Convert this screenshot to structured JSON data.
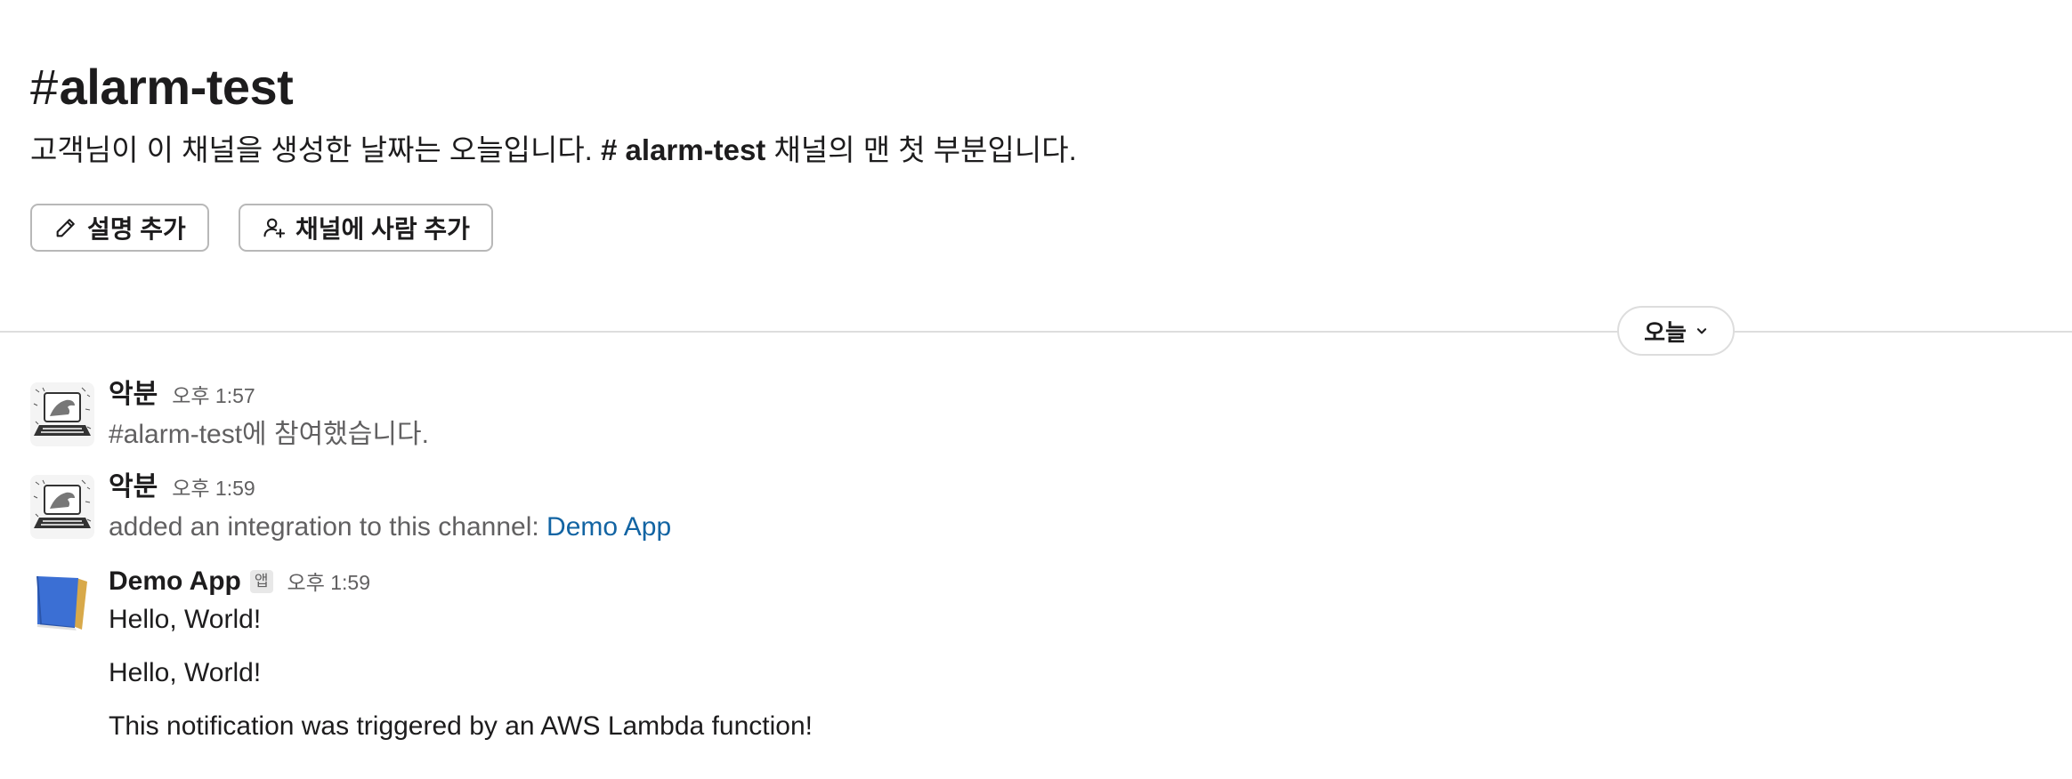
{
  "channel": {
    "hash": "#",
    "name": "alarm-test"
  },
  "intro": {
    "before": "고객님이 이 채널을 생성한 날짜는 오늘입니다.",
    "channel_ref": "# alarm-test",
    "after": "채널의 맨 첫 부분입니다."
  },
  "buttons": {
    "add_description": "설명 추가",
    "add_people": "채널에 사람 추가"
  },
  "date_divider": {
    "label": "오늘"
  },
  "messages": [
    {
      "author": "악분",
      "time": "오후 1:57",
      "text": "#alarm-test에 참여했습니다."
    },
    {
      "author": "악분",
      "time": "오후 1:59",
      "text": "added an integration to this channel:",
      "link": "Demo App"
    },
    {
      "author": "Demo App",
      "badge": "앱",
      "time": "오후 1:59",
      "lines": [
        "Hello, World!",
        "Hello, World!",
        "This notification was triggered by an AWS Lambda function!"
      ]
    }
  ],
  "colors": {
    "link": "#1264a3",
    "muted": "#616061",
    "divider": "#dddddd",
    "app_icon": "#3b6fd4"
  },
  "icons": {
    "add_description": "pencil-icon",
    "add_people": "add-person-icon",
    "date_dropdown": "chevron-down-icon"
  }
}
